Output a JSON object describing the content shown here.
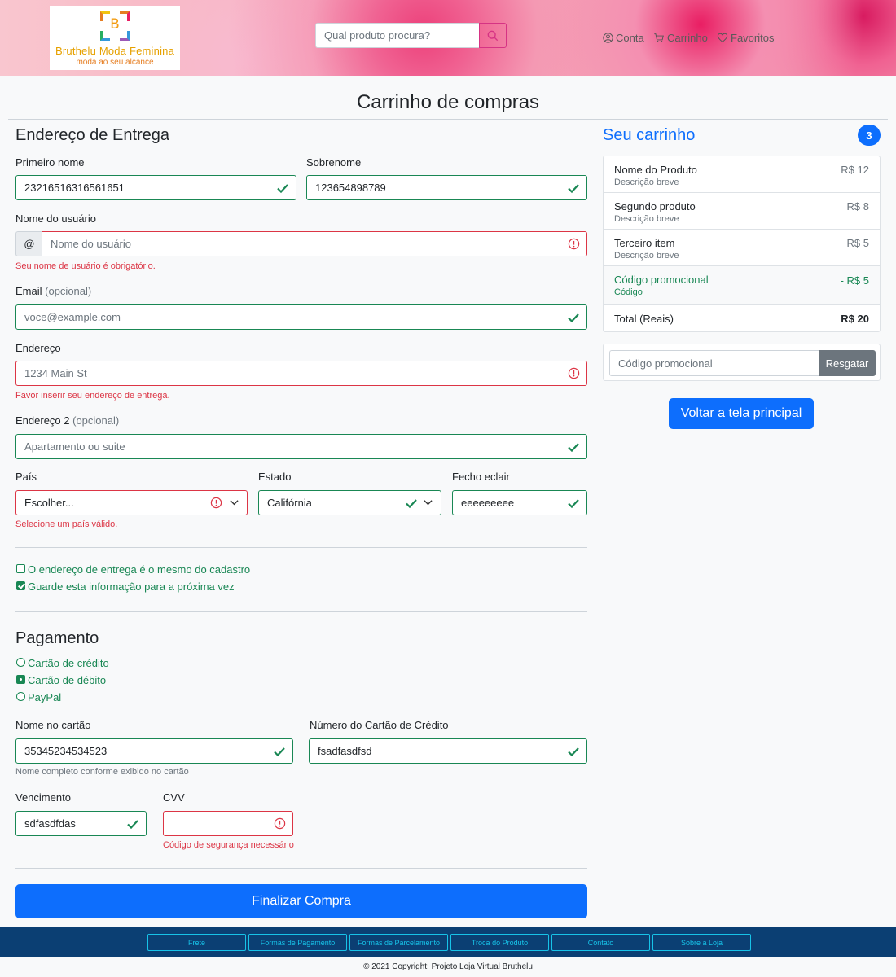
{
  "header": {
    "logo": {
      "letter": "B",
      "name": "Bruthelu Moda Feminina",
      "tagline": "moda ao seu alcance"
    },
    "search": {
      "placeholder": "Qual produto procura?"
    },
    "nav": {
      "account": "Conta",
      "cart": "Carrinho",
      "favorites": "Favoritos"
    }
  },
  "page_title": "Carrinho de compras",
  "shipping": {
    "heading": "Endereço de Entrega",
    "first_name": {
      "label": "Primeiro nome",
      "value": "23216516316561651"
    },
    "last_name": {
      "label": "Sobrenome",
      "value": "123654898789"
    },
    "username": {
      "label": "Nome do usuário",
      "prefix": "@",
      "placeholder": "Nome do usuário",
      "error": "Seu nome de usuário é obrigatório."
    },
    "email": {
      "label": "Email",
      "optional": "(opcional)",
      "placeholder": "voce@example.com"
    },
    "address": {
      "label": "Endereço",
      "placeholder": "1234 Main St",
      "error": "Favor inserir seu endereço de entrega."
    },
    "address2": {
      "label": "Endereço 2",
      "optional": "(opcional)",
      "placeholder": "Apartamento ou suite"
    },
    "country": {
      "label": "País",
      "value": "Escolher...",
      "error": "Selecione um país válido."
    },
    "state": {
      "label": "Estado",
      "value": "Califórnia"
    },
    "zip": {
      "label": "Fecho eclair",
      "value": "eeeeeeeee"
    },
    "same_address": {
      "label": "O endereço de entrega é o mesmo do cadastro",
      "checked": false
    },
    "save_info": {
      "label": "Guarde esta informação para a próxima vez",
      "checked": true
    }
  },
  "payment": {
    "heading": "Pagamento",
    "methods": [
      {
        "label": "Cartão de crédito",
        "selected": false
      },
      {
        "label": "Cartão de débito",
        "selected": true
      },
      {
        "label": "PayPal",
        "selected": false
      }
    ],
    "card_name": {
      "label": "Nome no cartão",
      "value": "35345234534523",
      "help": "Nome completo conforme exibido no cartão"
    },
    "card_number": {
      "label": "Número do Cartão de Crédito",
      "value": "fsadfasdfsd"
    },
    "expiration": {
      "label": "Vencimento",
      "value": "sdfasdfdas"
    },
    "cvv": {
      "label": "CVV",
      "value": "",
      "error": "Código de segurança necessário"
    },
    "submit": "Finalizar Compra"
  },
  "cart": {
    "title": "Seu carrinho",
    "count": "3",
    "items": [
      {
        "name": "Nome do Produto",
        "desc": "Descrição breve",
        "price": "R$ 12"
      },
      {
        "name": "Segundo produto",
        "desc": "Descrição breve",
        "price": "R$ 8"
      },
      {
        "name": "Terceiro item",
        "desc": "Descrição breve",
        "price": "R$ 5"
      }
    ],
    "promo": {
      "name": "Código promocional",
      "desc": "Código",
      "price": "- R$ 5"
    },
    "total": {
      "label": "Total (Reais)",
      "value": "R$ 20"
    },
    "promo_input": {
      "placeholder": "Código promocional",
      "button": "Resgatar"
    },
    "back_button": "Voltar a tela principal"
  },
  "footer": {
    "links": [
      "Frete",
      "Formas de Pagamento",
      "Formas de Parcelamento",
      "Troca do Produto",
      "Contato",
      "Sobre a Loja"
    ],
    "copyright": "© 2021 Copyright: Projeto Loja Virtual Bruthelu"
  },
  "colors": {
    "primary": "#0d6efd",
    "valid": "#198754",
    "invalid": "#dc3545",
    "footer": "#0b3f73",
    "footer_link": "#17c3e8"
  }
}
